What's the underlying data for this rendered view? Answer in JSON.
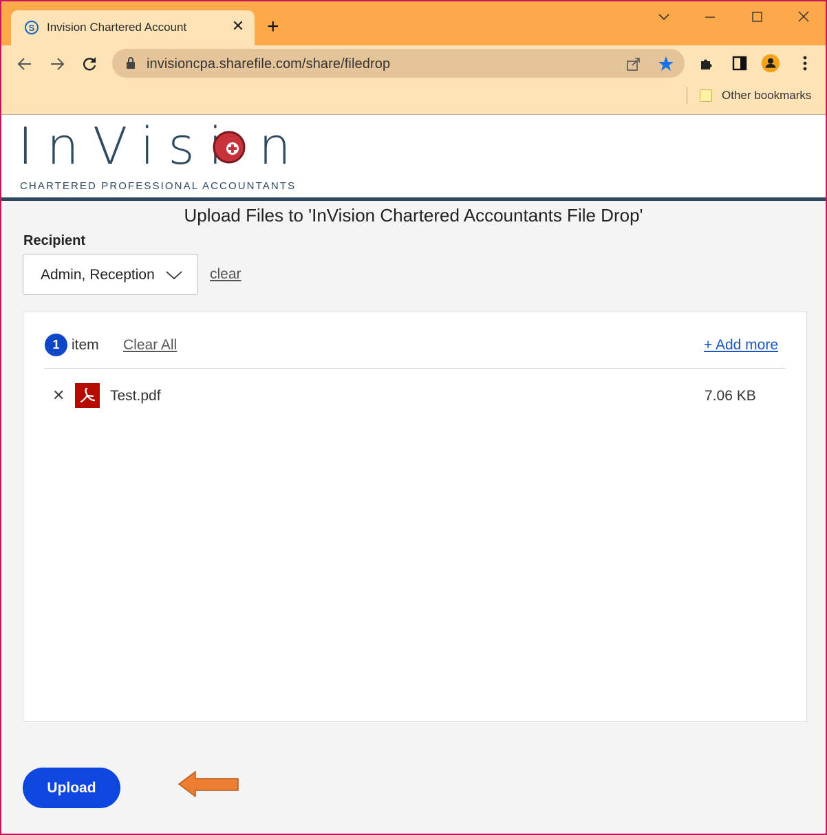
{
  "browser": {
    "tab_title": "Invision Chartered Account",
    "tab_close": "✕",
    "new_tab": "+",
    "url": "invisioncpa.sharefile.com/share/filedrop",
    "bookmarks_label": "Other bookmarks"
  },
  "header": {
    "logo_text_left": "InVisi",
    "logo_text_right": "n",
    "logo_subtitle": "CHARTERED PROFESSIONAL ACCOUNTANTS"
  },
  "page": {
    "title": "Upload Files to 'InVision Chartered Accountants File Drop'",
    "recipient_label": "Recipient",
    "recipient_value": "Admin, Reception",
    "clear_label": "clear"
  },
  "files_panel": {
    "count": "1",
    "count_label": "item",
    "clear_all_label": "Clear All",
    "add_more_label": "+ Add more",
    "files": [
      {
        "remove": "✕",
        "name": "Test.pdf",
        "size": "7.06 KB"
      }
    ]
  },
  "actions": {
    "upload_label": "Upload"
  },
  "colors": {
    "titlebar": "#fca94a",
    "toolbar": "#fde3b5",
    "brand_dark": "#2e4a5e",
    "logo_red": "#c8323b",
    "primary_blue": "#0d47e0",
    "pdf_red": "#b30b00",
    "annotation_arrow": "#ed7d31"
  }
}
